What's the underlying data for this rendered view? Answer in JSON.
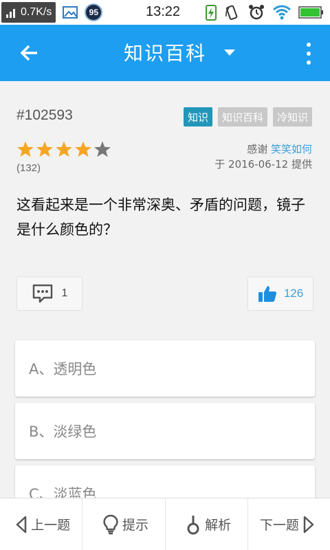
{
  "status_bar": {
    "net_speed": "0.7K/s",
    "badge": "95",
    "time": "13:22"
  },
  "app_bar": {
    "title": "知识百科",
    "back_icon": "arrow-left-icon",
    "menu_icon": "more-vertical-icon",
    "dropdown_icon": "caret-down-icon"
  },
  "question": {
    "id": "#102593",
    "tags": [
      "知识",
      "知识百科",
      "冷知识"
    ],
    "rating": 4,
    "rating_max": 5,
    "votes": "(132)",
    "credit_prefix": "感谢",
    "credit_user": "笑笑如何",
    "credit_date": "于 2016-06-12 提供",
    "text": "这看起来是一个非常深奥、矛盾的问题，镜子是什么颜色的？",
    "comments": "1",
    "likes": "126"
  },
  "options": [
    {
      "label": "A、透明色"
    },
    {
      "label": "B、淡绿色"
    },
    {
      "label": "C、淡蓝色"
    }
  ],
  "bottom_bar": {
    "prev": "上一题",
    "hint": "提示",
    "explain": "解析",
    "next": "下一题"
  },
  "colors": {
    "app_bar": "#1e9ef0",
    "star_on": "#f5a623",
    "star_off": "#777777",
    "accent": "#3aa0d8",
    "tag_primary": "#2296b8",
    "tag_secondary": "#c8c8c8"
  }
}
